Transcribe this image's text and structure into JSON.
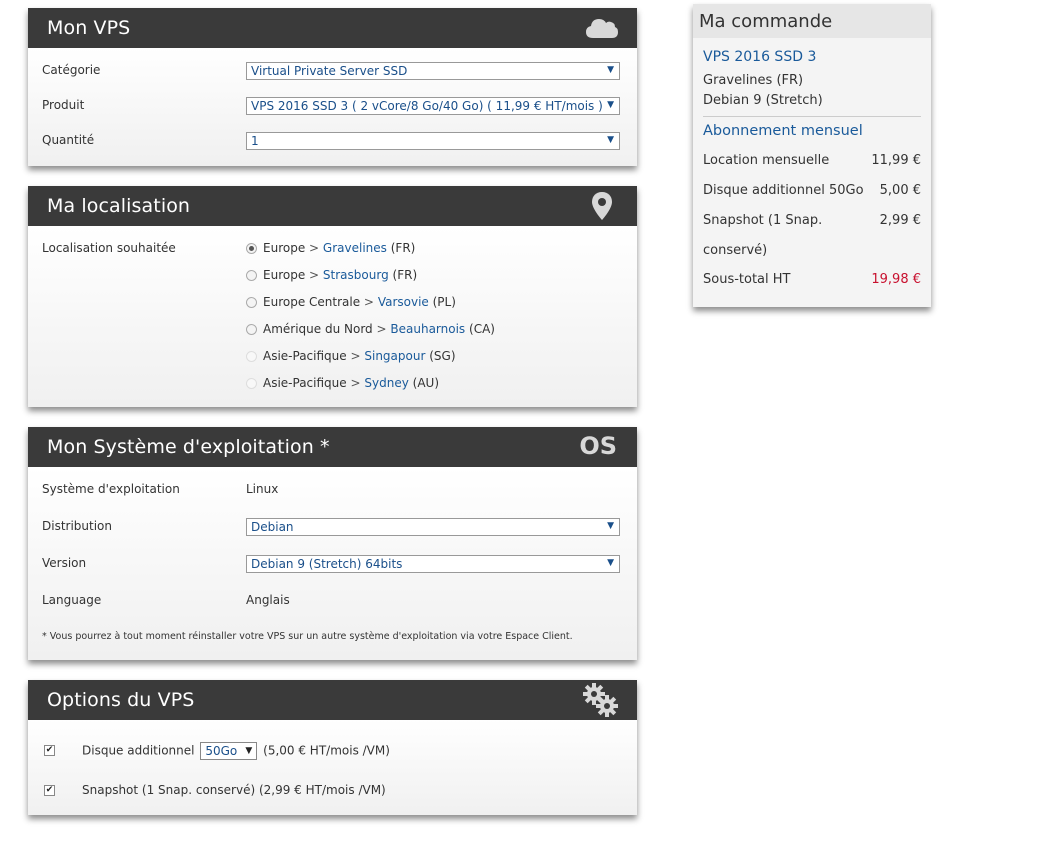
{
  "vps_panel": {
    "title": "Mon VPS",
    "icon": "cloud-icon",
    "categorie_label": "Catégorie",
    "categorie_value": "Virtual Private Server SSD",
    "produit_label": "Produit",
    "produit_value": "VPS 2016 SSD 3 ( 2 vCore/8 Go/40 Go) ( 11,99 € HT/mois )",
    "quantite_label": "Quantité",
    "quantite_value": "1"
  },
  "location_panel": {
    "title": "Ma localisation",
    "icon": "map-pin-icon",
    "label": "Localisation souhaitée",
    "options": [
      {
        "region": "Europe",
        "city": "Gravelines",
        "code": "(FR)",
        "checked": true,
        "disabled": false
      },
      {
        "region": "Europe",
        "city": "Strasbourg",
        "code": "(FR)",
        "checked": false,
        "disabled": false
      },
      {
        "region": "Europe Centrale",
        "city": "Varsovie",
        "code": "(PL)",
        "checked": false,
        "disabled": false
      },
      {
        "region": "Amérique du Nord",
        "city": "Beauharnois",
        "code": "(CA)",
        "checked": false,
        "disabled": false
      },
      {
        "region": "Asie-Pacifique",
        "city": "Singapour",
        "code": "(SG)",
        "checked": false,
        "disabled": true
      },
      {
        "region": "Asie-Pacifique",
        "city": "Sydney",
        "code": "(AU)",
        "checked": false,
        "disabled": true
      }
    ],
    "separator": ">"
  },
  "os_panel": {
    "title": "Mon Système d'exploitation *",
    "icon_text": "OS",
    "systeme_label": "Système d'exploitation",
    "systeme_value": "Linux",
    "distribution_label": "Distribution",
    "distribution_value": "Debian",
    "version_label": "Version",
    "version_value": "Debian 9 (Stretch) 64bits",
    "language_label": "Language",
    "language_value": "Anglais",
    "note": "* Vous pourrez à tout moment réinstaller votre VPS sur un autre système d'exploitation via votre Espace Client."
  },
  "options_panel": {
    "title": "Options du VPS",
    "icon": "gears-icon",
    "disque_label": "Disque additionnel",
    "disque_size": "50Go",
    "disque_price": "(5,00 € HT/mois /VM)",
    "snapshot_label": "Snapshot (1 Snap. conservé) (2,99 € HT/mois /VM)"
  },
  "order": {
    "title": "Ma commande",
    "product": "VPS 2016 SSD 3",
    "location": "Gravelines (FR)",
    "os": "Debian 9 (Stretch)",
    "subscription": "Abonnement mensuel",
    "lines": [
      {
        "label": "Location mensuelle",
        "price": "11,99 €"
      },
      {
        "label": "Disque additionnel 50Go",
        "price": "5,00 €"
      },
      {
        "label": "Snapshot (1 Snap.",
        "price": "2,99 €"
      },
      {
        "label": "conservé)",
        "price": ""
      }
    ],
    "subtotal_label": "Sous-total HT",
    "subtotal_price": "19,98 €"
  },
  "colors": {
    "header_dark": "#3a3a3a",
    "link_blue": "#1a5a9a",
    "total_red": "#c8102e"
  }
}
